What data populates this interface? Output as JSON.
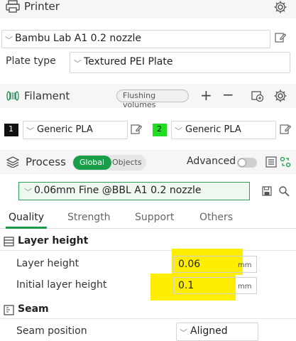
{
  "printer": {
    "title": "Printer",
    "selected": "Bambu Lab A1 0.2 nozzle",
    "plate_type_label": "Plate type",
    "plate_type_value": "Textured PEI Plate"
  },
  "filament": {
    "title": "Filament",
    "flushing_button": "Flushing volumes",
    "slots": [
      {
        "index": "1",
        "name": "Generic PLA",
        "swatch": "#111111"
      },
      {
        "index": "2",
        "name": "Generic PLA",
        "swatch": "#22dd22"
      }
    ]
  },
  "process": {
    "title": "Process",
    "toggle_global": "Global",
    "toggle_objects": "Objects",
    "advanced_label": "Advanced",
    "preset": "0.06mm Fine @BBL A1 0.2 nozzle",
    "tabs": [
      "Quality",
      "Strength",
      "Support",
      "Others"
    ],
    "active_tab": "Quality"
  },
  "layer_height_group": {
    "title": "Layer height",
    "rows": [
      {
        "label": "Layer height",
        "value": "0.06",
        "unit": "mm"
      },
      {
        "label": "Initial layer height",
        "value": "0.1",
        "unit": "mm"
      }
    ]
  },
  "seam_group": {
    "title": "Seam",
    "rows": [
      {
        "label": "Seam position",
        "value": "Aligned"
      }
    ]
  },
  "colors": {
    "accent_green": "#1a9e4a",
    "highlight_yellow": "#ffee00"
  },
  "icons": [
    "printer-icon",
    "gear-icon",
    "edit-icon",
    "filament-icon",
    "plus-icon",
    "minus-icon",
    "sync-icon",
    "process-icon",
    "list-icon",
    "compare-icon",
    "save-icon",
    "search-icon",
    "layers-icon",
    "seam-icon",
    "chevron-down-icon"
  ]
}
